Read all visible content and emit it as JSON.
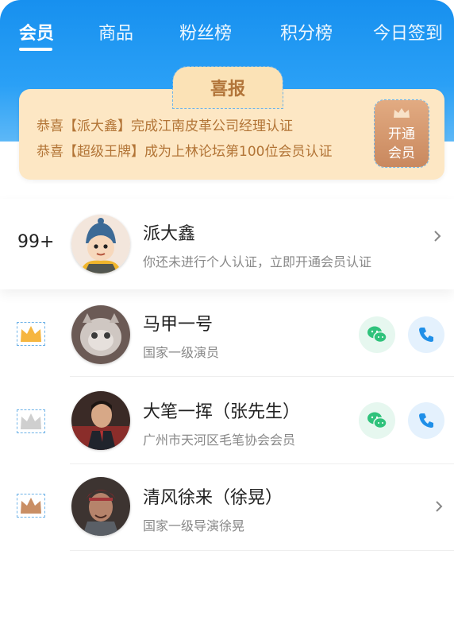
{
  "tabs": [
    {
      "label": "会员",
      "active": true
    },
    {
      "label": "商品"
    },
    {
      "label": "粉丝榜"
    },
    {
      "label": "积分榜"
    },
    {
      "label": "今日签到"
    }
  ],
  "notice": {
    "title": "喜报",
    "lines": [
      "恭喜【派大鑫】完成江南皮革公司经理认证",
      "恭喜【超级王牌】成为上林论坛第100位会员认证"
    ],
    "vip_button": {
      "line1": "开通",
      "line2": "会员",
      "icon": "crown-icon"
    }
  },
  "me": {
    "rank": "99+",
    "name": "派大鑫",
    "subtitle": "你还未进行个人认证，立即开通会员认证"
  },
  "members": [
    {
      "name": "马甲一号",
      "subtitle": "国家一级演员",
      "crown_color": "#f6b63f",
      "actions": [
        "wechat",
        "phone"
      ]
    },
    {
      "name": "大笔一挥（张先生）",
      "subtitle": "广州市天河区毛笔协会会员",
      "crown_color": "#cfcfcf",
      "actions": [
        "wechat",
        "phone"
      ]
    },
    {
      "name": "清风徐来（徐晃）",
      "subtitle": "国家一级导演徐晃",
      "crown_color": "#c98e64",
      "actions": [
        "chevron"
      ]
    }
  ],
  "colors": {
    "primary": "#1790ef",
    "notice_bg": "#fde7c4",
    "notice_text": "#b27436",
    "wechat_green": "#2fc27b",
    "phone_blue": "#1f8fe8"
  }
}
